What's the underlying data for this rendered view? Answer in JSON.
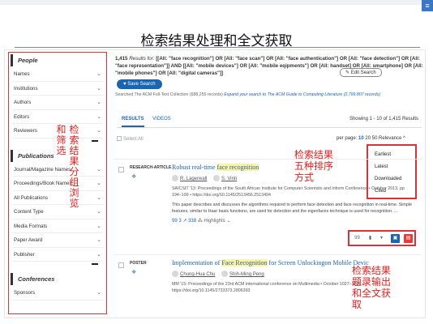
{
  "slide": {
    "title": "检索结果处理和全文获取",
    "corner_badge": "≡"
  },
  "sidebar": {
    "sections": [
      {
        "title": "People",
        "items": [
          "Names",
          "Institutions",
          "Authors",
          "Editors",
          "Reviewers"
        ]
      },
      {
        "title": "Publications",
        "items": [
          "Journal/Magazine Names",
          "Proceedings/Book Names",
          "All Publications",
          "Content Type",
          "Media Formats",
          "Paper Award",
          "Publisher"
        ]
      },
      {
        "title": "Conferences",
        "items": [
          "Sponsors"
        ]
      }
    ]
  },
  "annotations": {
    "filter_left": "和筛选",
    "filter_right": "检索结果分组浏览",
    "sort": "检索结果\n五种排序\n方式",
    "export": "检索结果\n题录输出\n和全文获\n取"
  },
  "search": {
    "count": "1,415",
    "results_for": " Results for: ",
    "query": "[[All: \"face recognition\"] OR [All: \"face scan\"] OR [All: \"face authentication\"] OR [All: \"face detection\"] OR [All: \"face representation\"]] AND [[All: \"mobile devices\"] OR [All: \"mobile eqipments\"] OR [All: handset] OR [All: smartphone] OR [All: \"mobile phones\"] OR [All: \"digital cameras\"]]",
    "edit_label": "Edit Search",
    "save_label": "Save Search",
    "searched_text": "Searched The ACM Full-Text Collection (688,255 records)",
    "expand_text": "Expand your search to The ACM Guide to Computing Literature (2,799,807 records)"
  },
  "tabs": {
    "results": "RESULTS",
    "videos": "VIDEOS"
  },
  "showing": "Showing 1 - 10 of 1,415 Results",
  "toolbar": {
    "select_all": "Select All",
    "per_page_label": "per page:",
    "per_page_options": [
      "10",
      "20",
      "50"
    ],
    "relevance": "Relevance ^"
  },
  "sort_options": [
    "Earliest",
    "Latest",
    "Downloaded",
    "Cited"
  ],
  "results": [
    {
      "type": "RESEARCH-ARTICLE",
      "title_pre": "Robust real-time ",
      "title_mark": "face recognition",
      "title_post": "",
      "authors": [
        "R. Lagerwall",
        "S. Viriri"
      ],
      "meta": "SAICSIT '13: Proceedings of the South African Institute for Computer Scientists and Inform Conference • October 2013, pp 194–199 • https://doi.org/10.1145/2513456.2513494",
      "abstract": "This paper describes and discusses the algorithms required to perform face detection and face recognition in real-time. Simple features, similar to Haar basis functions, are used for detection and the eigenfaces technique is used for recognition. ...",
      "citations": "3",
      "downloads": "338",
      "highlights": "Highlights"
    },
    {
      "type": "POSTER",
      "title_pre": "Implementation of ",
      "title_mark": "Face Recognition",
      "title_post": " for Screen Unlockingon Mobile Devic",
      "authors": [
        "Chung-Hua Chu",
        "Shih-Ming Peng"
      ],
      "meta": "MM '15: Proceedings of the 23rd ACM international conference on Multimedia • October 1027–1030 • https://doi.org/10.1145/2733373.2806393"
    }
  ],
  "actions": {
    "quote": "99",
    "folder": "▮",
    "export": "▾",
    "download": "▣",
    "pdf": "▤"
  }
}
